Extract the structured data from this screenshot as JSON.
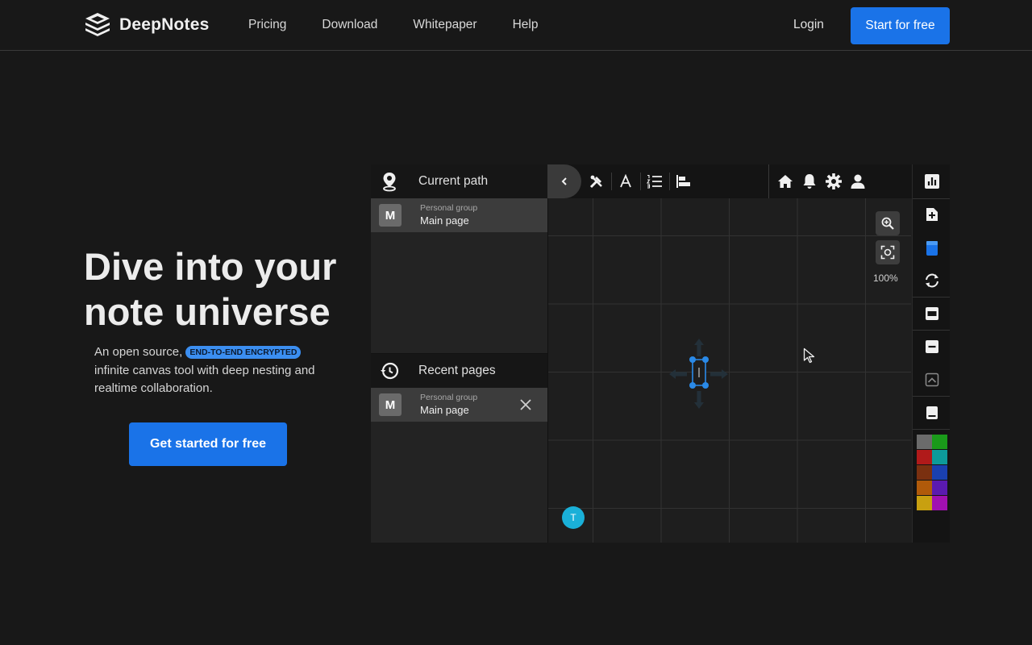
{
  "nav": {
    "brand": "DeepNotes",
    "links": [
      "Pricing",
      "Download",
      "Whitepaper",
      "Help"
    ],
    "login": "Login",
    "cta": "Start for free"
  },
  "hero": {
    "title_line1": "Dive into your",
    "title_line2": "note universe",
    "desc_pre": "An open source,",
    "badge": "END-TO-END ENCRYPTED",
    "desc_post": "infinite canvas tool with deep nesting and realtime collaboration.",
    "cta": "Get started for free"
  },
  "app": {
    "current_path": {
      "title": "Current path",
      "item": {
        "avatar": "M",
        "group": "Personal group",
        "page": "Main page"
      }
    },
    "recent_pages": {
      "title": "Recent pages",
      "item": {
        "avatar": "M",
        "group": "Personal group",
        "page": "Main page"
      }
    },
    "canvas": {
      "zoom_level": "100%",
      "user_initial": "T"
    },
    "toolbar_icons": [
      "back-icon",
      "tools-icon",
      "text-format-icon",
      "list-icon",
      "align-icon",
      "home-icon",
      "bell-icon",
      "gear-icon",
      "user-icon",
      "chevron-left-icon"
    ],
    "sidebar_icons": [
      "chart-icon",
      "add-page-icon",
      "note-icon",
      "sync-icon",
      "window-icon",
      "minus-icon",
      "image-icon",
      "bottom-bar-icon"
    ],
    "palette": [
      [
        "#6b6b6b",
        "#1a9a1a"
      ],
      [
        "#b01a1a",
        "#0d9a9a"
      ],
      [
        "#7a3010",
        "#1a40b0"
      ],
      [
        "#b05a0a",
        "#5a1ab0"
      ],
      [
        "#c8a010",
        "#a010b0"
      ]
    ],
    "colors": {
      "accent": "#1a73e8",
      "selection": "#2a8ae8"
    }
  }
}
